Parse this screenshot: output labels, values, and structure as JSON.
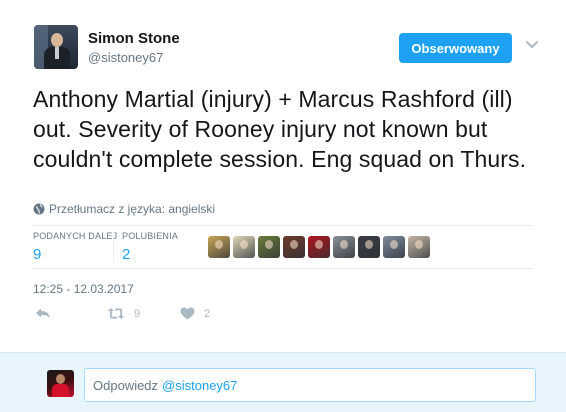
{
  "author": {
    "name": "Simon Stone",
    "handle": "@sistoney67"
  },
  "follow_button": {
    "label": "Obserwowany",
    "color": "#1da1f2"
  },
  "tweet": {
    "text": "Anthony Martial (injury) + Marcus Rashford (ill) out. Severity of Rooney injury not known but couldn't complete session. Eng squad on Thurs.",
    "translate_label": "Przetłumacz z języka: angielski",
    "timestamp": "12:25 - 12.03.2017"
  },
  "stats": {
    "retweets": {
      "label": "PODANYCH DALEJ",
      "value": "9"
    },
    "likes": {
      "label": "POLUBIENIA",
      "value": "2"
    }
  },
  "likers": [
    {
      "icon": "liker-avatar-1",
      "color": "#c9a456"
    },
    {
      "icon": "liker-avatar-2",
      "color": "#e0d7b8"
    },
    {
      "icon": "liker-avatar-3",
      "color": "#6b7b3a"
    },
    {
      "icon": "liker-avatar-4",
      "color": "#6e3b2a"
    },
    {
      "icon": "liker-avatar-5",
      "color": "#b0161d"
    },
    {
      "icon": "liker-avatar-6",
      "color": "#8a8f96"
    },
    {
      "icon": "liker-avatar-7",
      "color": "#3a3d44"
    },
    {
      "icon": "liker-avatar-8",
      "color": "#7d8c9a"
    },
    {
      "icon": "liker-avatar-9",
      "color": "#c6b7a5"
    }
  ],
  "actions": {
    "reply_icon": "reply-arrow-icon",
    "retweet_icon": "retweet-icon",
    "retweet_count": "9",
    "like_icon": "heart-icon",
    "like_count": "2"
  },
  "reply_box": {
    "placeholder": "Odpowiedz",
    "mention": "@sistoney67"
  }
}
